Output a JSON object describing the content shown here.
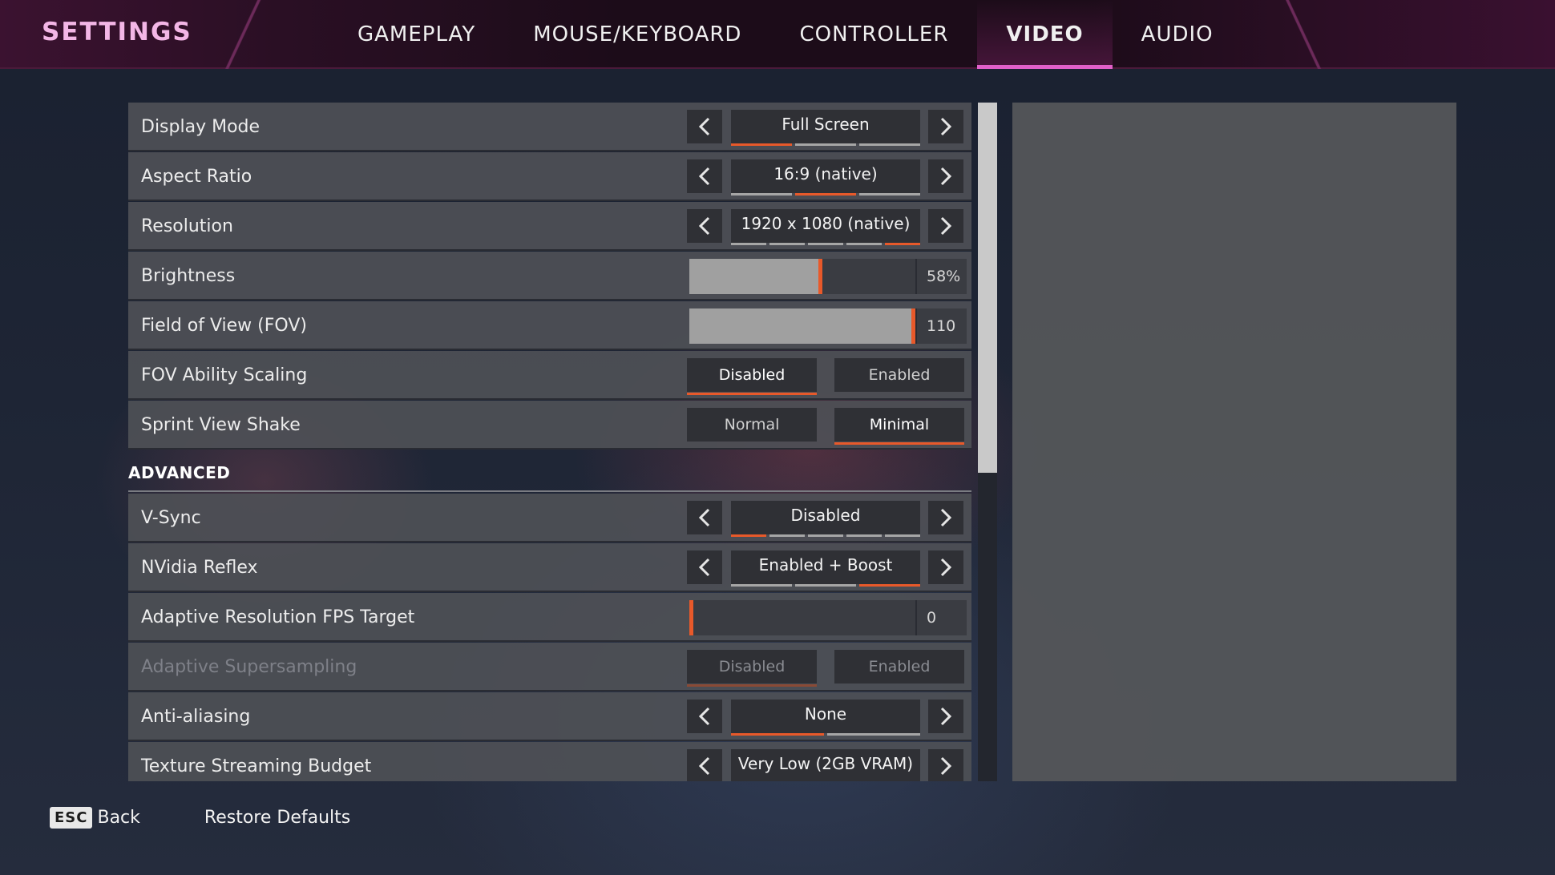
{
  "header": {
    "title": "SETTINGS",
    "tabs": [
      {
        "label": "GAMEPLAY",
        "active": false
      },
      {
        "label": "MOUSE/KEYBOARD",
        "active": false
      },
      {
        "label": "CONTROLLER",
        "active": false
      },
      {
        "label": "VIDEO",
        "active": true
      },
      {
        "label": "AUDIO",
        "active": false
      }
    ]
  },
  "colors": {
    "accent": "#e8592a",
    "tab_highlight": "#e060c8",
    "title": "#f3b6e6"
  },
  "settings": {
    "display_mode": {
      "label": "Display Mode",
      "value": "Full Screen",
      "options_count": 3,
      "selected_index": 0
    },
    "aspect_ratio": {
      "label": "Aspect Ratio",
      "value": "16:9 (native)",
      "options_count": 3,
      "selected_index": 1
    },
    "resolution": {
      "label": "Resolution",
      "value": "1920 x 1080 (native)",
      "options_count": 5,
      "selected_index": 4
    },
    "brightness": {
      "label": "Brightness",
      "value": "58%",
      "fill_fraction": 0.58
    },
    "fov": {
      "label": "Field of View (FOV)",
      "value": "110",
      "fill_fraction": 1.0
    },
    "fov_ability_scaling": {
      "label": "FOV Ability Scaling",
      "option_1": "Disabled",
      "option_2": "Enabled",
      "selected": 1
    },
    "sprint_view_shake": {
      "label": "Sprint View Shake",
      "option_1": "Normal",
      "option_2": "Minimal",
      "selected": 2
    }
  },
  "advanced": {
    "header": "ADVANCED",
    "vsync": {
      "label": "V-Sync",
      "value": "Disabled",
      "options_count": 5,
      "selected_index": 0
    },
    "nvidia_reflex": {
      "label": "NVidia Reflex",
      "value": "Enabled + Boost",
      "options_count": 3,
      "selected_index": 2
    },
    "adaptive_res": {
      "label": "Adaptive Resolution FPS Target",
      "value": "0",
      "fill_fraction": 0.0
    },
    "adaptive_supersampling": {
      "label": "Adaptive Supersampling",
      "option_1": "Disabled",
      "option_2": "Enabled",
      "selected": 1,
      "disabled": true
    },
    "anti_aliasing": {
      "label": "Anti-aliasing",
      "value": "None",
      "options_count": 2,
      "selected_index": 0
    },
    "texture_budget": {
      "label": "Texture Streaming Budget",
      "value": "Very Low (2GB VRAM)"
    }
  },
  "footer": {
    "esc_key": "ESC",
    "back_label": "Back",
    "restore_label": "Restore Defaults"
  }
}
